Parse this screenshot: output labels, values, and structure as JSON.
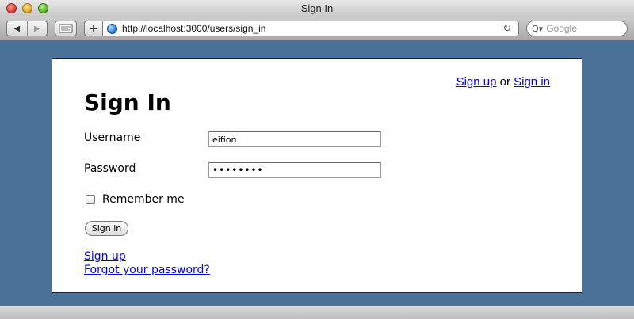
{
  "window": {
    "title": "Sign In"
  },
  "toolbar": {
    "back_icon": "◀",
    "forward_icon": "▶",
    "add_icon": "+",
    "url": "http://localhost:3000/users/sign_in",
    "reload_icon": "↻",
    "search_placeholder": "Google",
    "search_icon": "Q▾"
  },
  "page": {
    "top_links": {
      "sign_up": "Sign up",
      "separator": "or",
      "sign_in": "Sign in"
    },
    "title": "Sign In",
    "form": {
      "username_label": "Username",
      "username_value": "eifion",
      "password_label": "Password",
      "password_masked": "••••••••",
      "remember_label": "Remember me",
      "remember_checked": false,
      "submit_label": "Sign in"
    },
    "bottom_links": {
      "sign_up": "Sign up",
      "forgot_password": "Forgot your password?"
    }
  },
  "colors": {
    "page_background": "#4a7298",
    "link": "#0000ee"
  }
}
